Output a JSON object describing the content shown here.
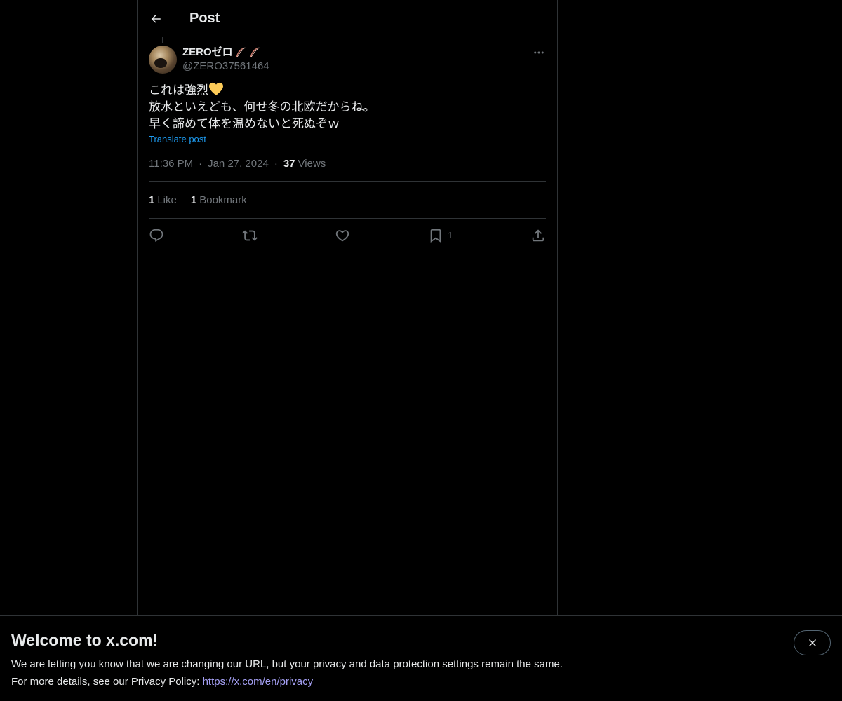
{
  "header": {
    "title": "Post"
  },
  "author": {
    "display_name": "ZEROゼロ",
    "handle": "@ZERO37561464"
  },
  "tweet": {
    "line1": "これは強烈",
    "line2": "放水といえども、何せ冬の北欧だからね。",
    "line3": "早く諦めて体を温めないと死ぬぞｗ",
    "translate_label": "Translate post"
  },
  "meta": {
    "time": "11:36 PM",
    "separator": "·",
    "date": "Jan 27, 2024",
    "views_count": "37",
    "views_label": "Views"
  },
  "stats": {
    "likes_count": "1",
    "likes_label": "Like",
    "bookmarks_count": "1",
    "bookmarks_label": "Bookmark"
  },
  "actions": {
    "bookmark_count": "1"
  },
  "banner": {
    "title": "Welcome to x.com!",
    "line1": "We are letting you know that we are changing our URL, but your privacy and data protection settings remain the same.",
    "line2_prefix": "For more details, see our Privacy Policy: ",
    "link": "https://x.com/en/privacy"
  },
  "icons": {
    "back": "arrow-left-icon",
    "more": "more-horizontal-icon",
    "reply": "reply-icon",
    "repost": "repost-icon",
    "like": "heart-icon",
    "bookmark": "bookmark-icon",
    "share": "share-icon",
    "close": "close-icon"
  },
  "colors": {
    "background": "#000000",
    "text": "#e7e9ea",
    "muted": "#71767b",
    "link": "#1d9bf0",
    "border": "#2f3336"
  }
}
